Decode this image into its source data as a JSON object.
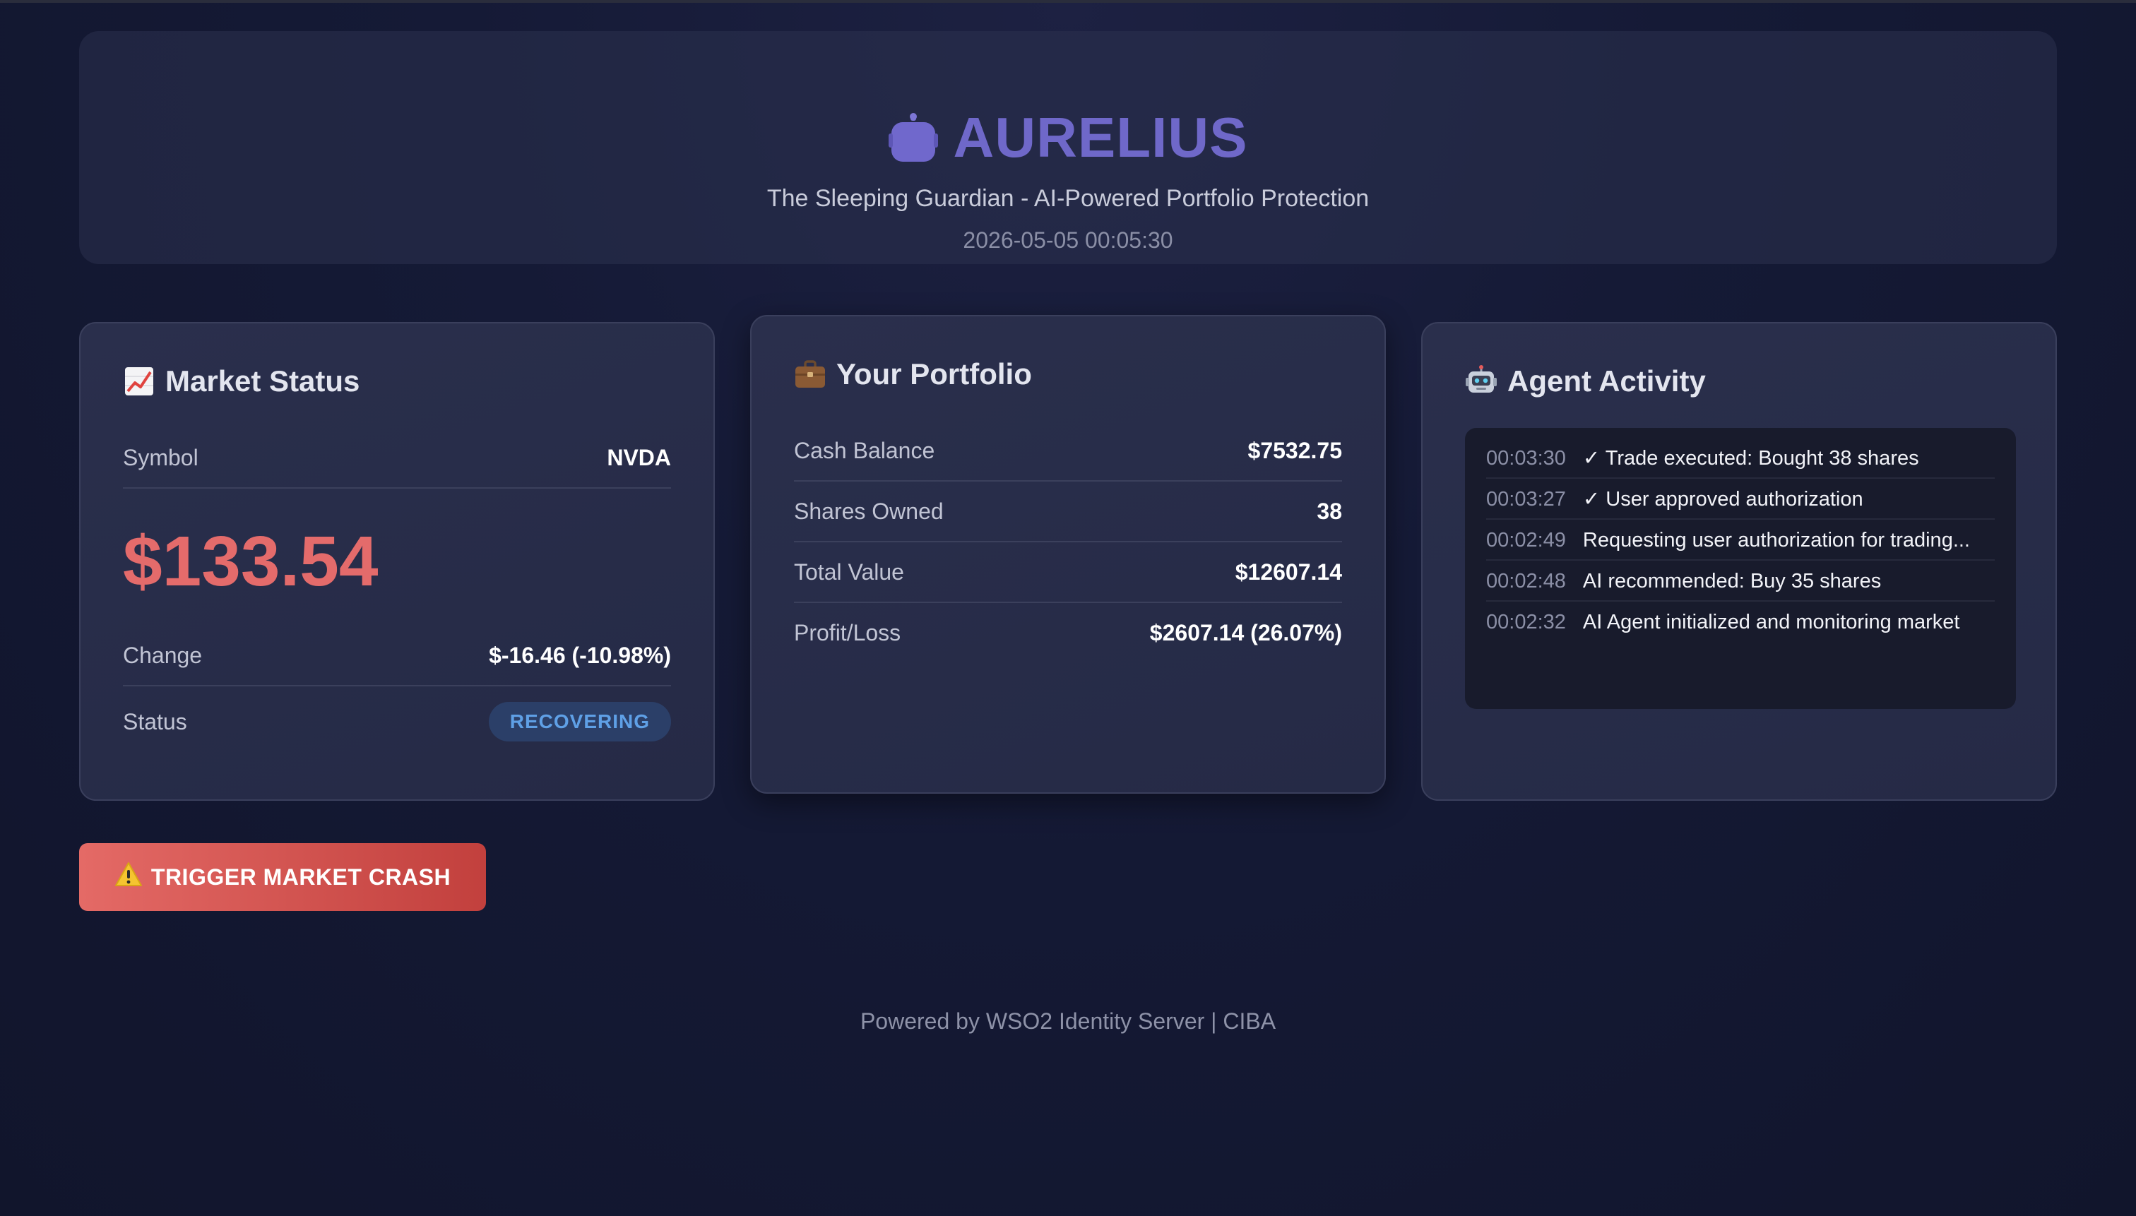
{
  "header": {
    "title": "AURELIUS",
    "subtitle": "The Sleeping Guardian - AI-Powered Portfolio Protection",
    "timestamp": "2026-05-05 00:05:30"
  },
  "market": {
    "title": "Market Status",
    "icon": "chart-up-icon",
    "symbol_label": "Symbol",
    "symbol_value": "NVDA",
    "price": "$133.54",
    "change_label": "Change",
    "change_value": "$-16.46 (-10.98%)",
    "status_label": "Status",
    "status_value": "RECOVERING"
  },
  "portfolio": {
    "title": "Your Portfolio",
    "icon": "briefcase-icon",
    "rows": [
      {
        "label": "Cash Balance",
        "value": "$7532.75"
      },
      {
        "label": "Shares Owned",
        "value": "38"
      },
      {
        "label": "Total Value",
        "value": "$12607.14"
      },
      {
        "label": "Profit/Loss",
        "value": "$2607.14 (26.07%)"
      }
    ]
  },
  "agent": {
    "title": "Agent Activity",
    "icon": "robot-icon",
    "log": [
      {
        "time": "00:03:30",
        "message": "✓ Trade executed: Bought 38 shares"
      },
      {
        "time": "00:03:27",
        "message": "✓ User approved authorization"
      },
      {
        "time": "00:02:49",
        "message": "Requesting user authorization for trading..."
      },
      {
        "time": "00:02:48",
        "message": "AI recommended: Buy 35 shares"
      },
      {
        "time": "00:02:32",
        "message": "AI Agent initialized and monitoring market"
      }
    ]
  },
  "actions": {
    "crash_button_label": "TRIGGER MARKET CRASH",
    "crash_button_icon": "warning-icon"
  },
  "footer": {
    "text": "Powered by WSO2 Identity Server | CIBA"
  },
  "colors": {
    "accent": "#6f68c9",
    "negative": "#e46b6b",
    "badge_text": "#5fa0e6",
    "badge_bg": "#2b3f68",
    "danger_button": "#d2504c"
  }
}
